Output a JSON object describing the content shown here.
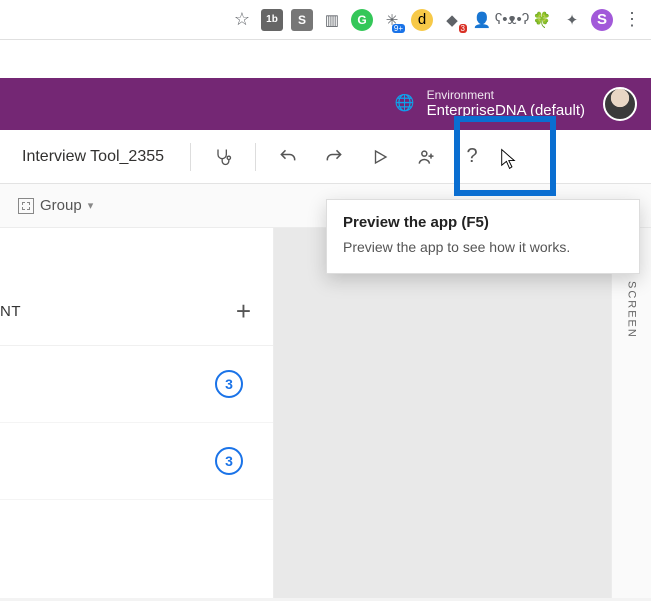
{
  "chrome": {
    "profile_initial": "S",
    "badge_nine": "9+"
  },
  "environment": {
    "label": "Environment",
    "value": "EnterpriseDNA (default)"
  },
  "toolbar": {
    "app_name": "Interview Tool_2355"
  },
  "subtoolbar": {
    "group_label": "Group"
  },
  "tooltip": {
    "title": "Preview the app (F5)",
    "body": "Preview the app to see how it works."
  },
  "left_panel": {
    "header_fragment": "NT",
    "rows": [
      {
        "badge": "3"
      },
      {
        "badge": "3"
      }
    ]
  },
  "right_rail": {
    "label": "SCREEN"
  }
}
